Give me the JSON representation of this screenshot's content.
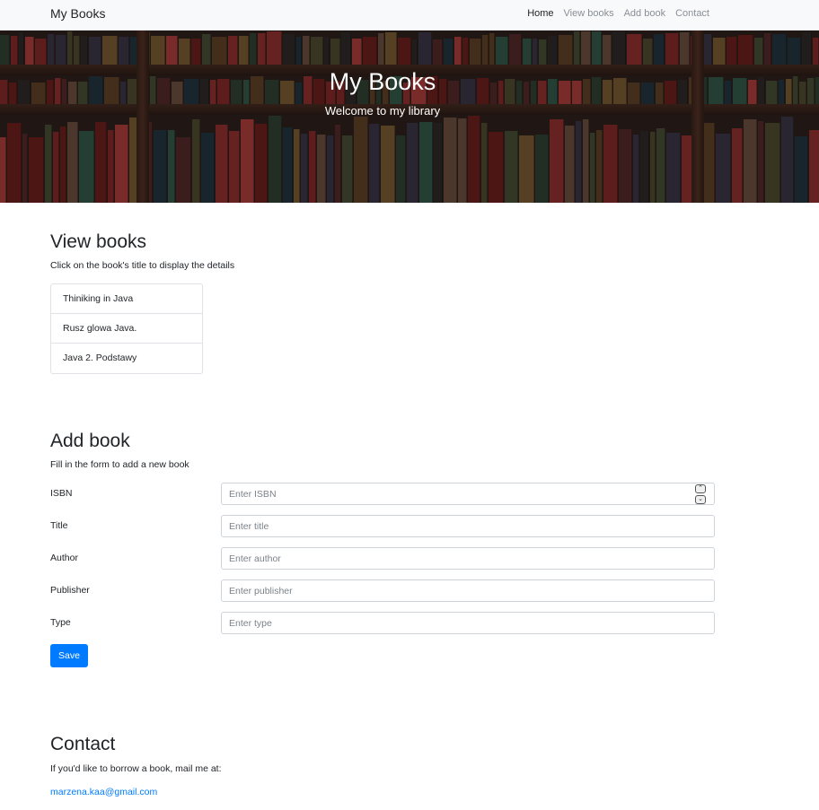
{
  "navbar": {
    "brand": "My Books",
    "links": [
      {
        "label": "Home",
        "active": true
      },
      {
        "label": "View books",
        "active": false
      },
      {
        "label": "Add book",
        "active": false
      },
      {
        "label": "Contact",
        "active": false
      }
    ]
  },
  "hero": {
    "title": "My Books",
    "subtitle": "Welcome to my library"
  },
  "view_books": {
    "title": "View books",
    "description": "Click on the book's title to display the details",
    "books": [
      "Thiniking in Java",
      "Rusz glowa Java.",
      "Java 2. Podstawy"
    ]
  },
  "add_book": {
    "title": "Add book",
    "description": "Fill in the form to add a new book",
    "fields": [
      {
        "label": "ISBN",
        "placeholder": "Enter ISBN",
        "value": ""
      },
      {
        "label": "Title",
        "placeholder": "Enter title",
        "value": ""
      },
      {
        "label": "Author",
        "placeholder": "Enter author",
        "value": ""
      },
      {
        "label": "Publisher",
        "placeholder": "Enter publisher",
        "value": ""
      },
      {
        "label": "Type",
        "placeholder": "Enter type",
        "value": ""
      }
    ],
    "save_label": "Save"
  },
  "contact": {
    "title": "Contact",
    "text": "If you'd like to borrow a book, mail me at:",
    "email": "marzena.kaa@gmail.com"
  },
  "colors": {
    "primary": "#007bff",
    "navbar_bg": "#f8f9fa",
    "text": "#212529"
  }
}
